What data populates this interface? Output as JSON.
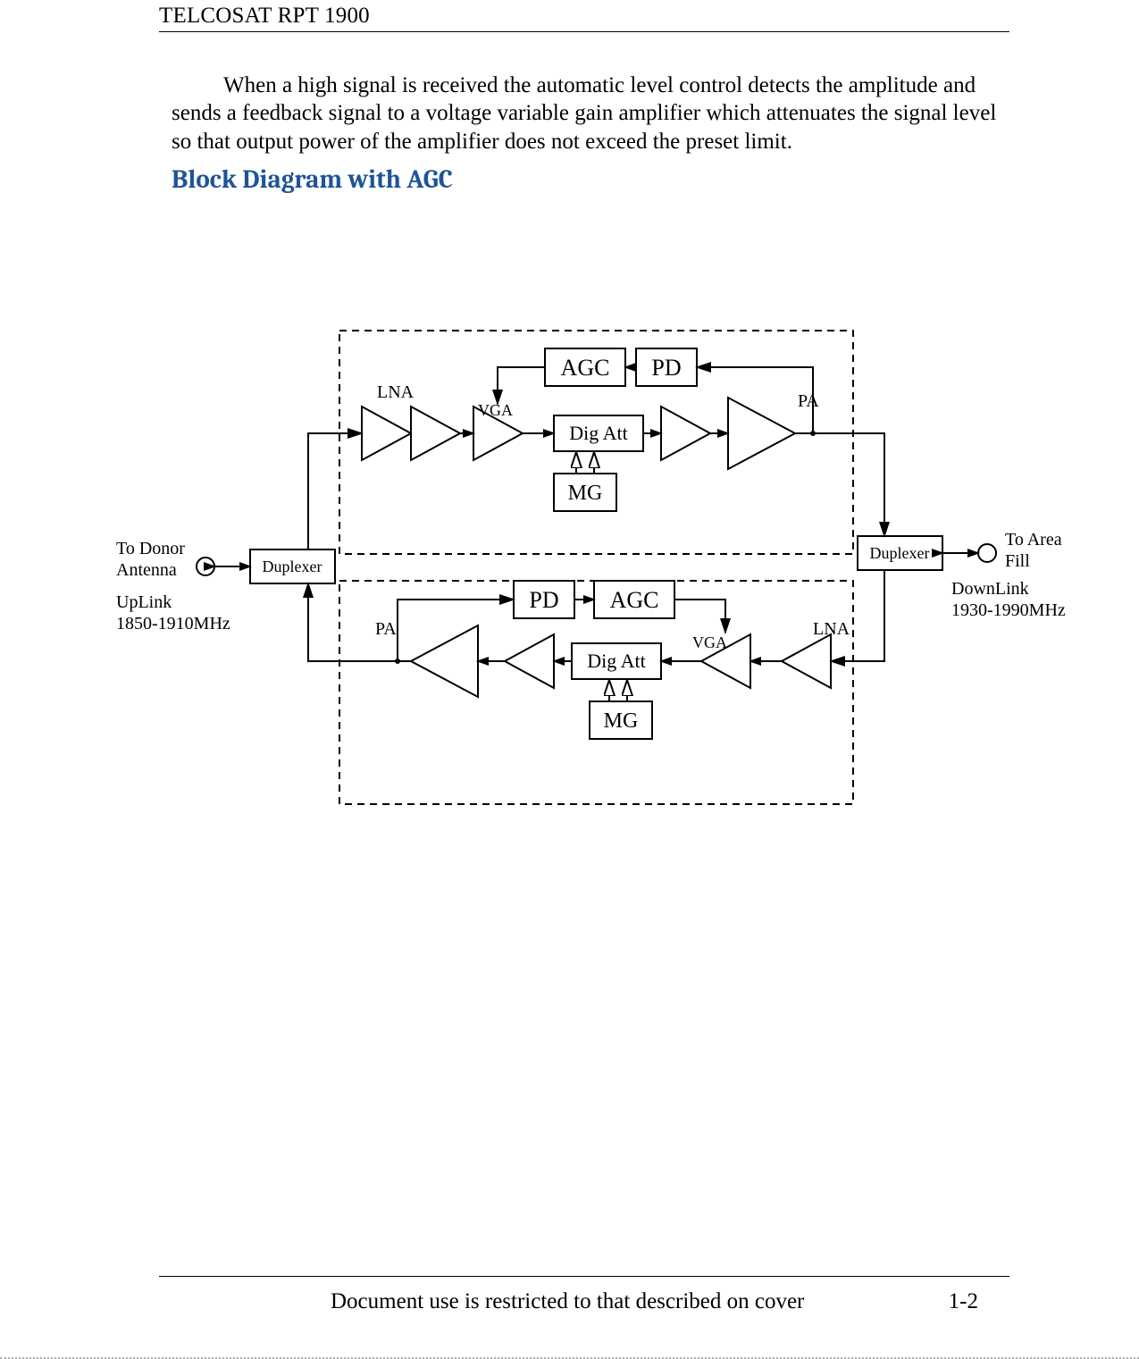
{
  "header": {
    "title": "TELCOSAT RPT 1900"
  },
  "body": {
    "paragraph": "When a high signal is received the automatic level control detects the amplitude and sends a feedback signal to a voltage variable gain amplifier which attenuates the signal level so that output power of the amplifier does not exceed the preset limit."
  },
  "section": {
    "heading": "Block Diagram with AGC"
  },
  "diagram": {
    "left_antenna": {
      "label1": "To Donor",
      "label2": "Antenna"
    },
    "uplink": {
      "label1": "UpLink",
      "label2": "1850-1910MHz"
    },
    "right_antenna": {
      "label1": "To Area",
      "label2": "Fill"
    },
    "downlink": {
      "label1": "DownLink",
      "label2": "1930-1990MHz"
    },
    "left_duplexer": "Duplexer",
    "right_duplexer": "Duplexer",
    "top": {
      "lna": "LNA",
      "vga": "VGA",
      "dig_att": "Dig Att",
      "mg": "MG",
      "agc": "AGC",
      "pd": "PD",
      "pa": "PA"
    },
    "bottom": {
      "lna": "LNA",
      "vga": "VGA",
      "dig_att": "Dig Att",
      "mg": "MG",
      "agc": "AGC",
      "pd": "PD",
      "pa": "PA"
    }
  },
  "footer": {
    "text": "Document use is restricted to that described on cover",
    "page": "1-2"
  }
}
